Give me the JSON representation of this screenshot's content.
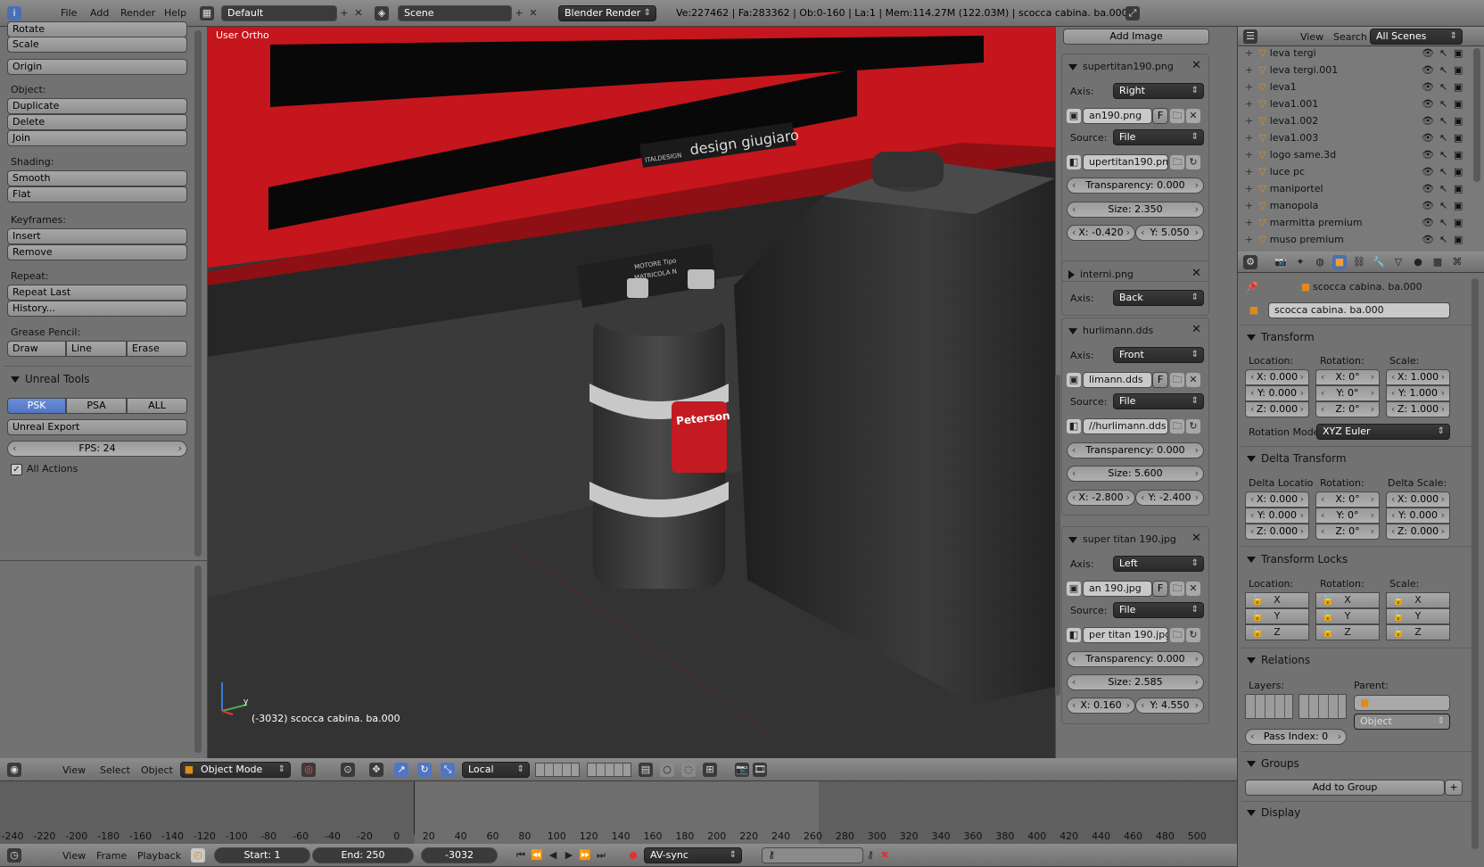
{
  "top_bar": {
    "menus": [
      "File",
      "Add",
      "Render",
      "Help"
    ],
    "layout": "Default",
    "scene": "Scene",
    "engine": "Blender Render",
    "stats": "Ve:227462 | Fa:283362 | Ob:0-160 | La:1 | Mem:114.27M (122.03M) | scocca cabina. ba.000"
  },
  "tools": {
    "rotate": "Rotate",
    "scale": "Scale",
    "origin": "Origin",
    "object_label": "Object:",
    "duplicate": "Duplicate",
    "delete": "Delete",
    "join": "Join",
    "shading_label": "Shading:",
    "smooth": "Smooth",
    "flat": "Flat",
    "keyframes_label": "Keyframes:",
    "insert": "Insert",
    "remove": "Remove",
    "repeat_label": "Repeat:",
    "repeat_last": "Repeat Last",
    "history": "History...",
    "grease_label": "Grease Pencil:",
    "draw": "Draw",
    "line": "Line",
    "erase": "Erase",
    "unreal_title": "Unreal Tools",
    "psk": "PSK",
    "psa": "PSA",
    "all": "ALL",
    "unreal_export": "Unreal Export",
    "fps": "FPS: 24",
    "all_actions": "All Actions"
  },
  "viewport": {
    "view_label": "User Ortho",
    "object_label": "(-3032) scocca cabina. ba.000",
    "logo_text": "design giugiaro",
    "logo_small": "ITALDESIGN",
    "plate_text_1": "MOTORE Tipo",
    "plate_text_2": "MATRICOLA N",
    "badge_text": "Peterson",
    "axis_y": "y"
  },
  "bg_panel": {
    "add_image": "Add Image",
    "images": [
      {
        "name": "supertitan190.png",
        "axis": "Right",
        "file": "an190.png",
        "source": "File",
        "path": "upertitan190.png",
        "transparency": "Transparency: 0.000",
        "size": "Size: 2.350",
        "x": "X: -0.420",
        "y": "Y: 5.050",
        "expanded": true
      },
      {
        "name": "interni.png",
        "axis": "Back",
        "expanded": false
      },
      {
        "name": "hurlimann.dds",
        "axis": "Front",
        "file": "limann.dds",
        "source": "File",
        "path": "//hurlimann.dds",
        "transparency": "Transparency: 0.000",
        "size": "Size: 5.600",
        "x": "X: -2.800",
        "y": "Y: -2.400",
        "expanded": true
      },
      {
        "name": "super titan 190.jpg",
        "axis": "Left",
        "file": "an 190.jpg",
        "source": "File",
        "path": "per titan 190.jpg",
        "transparency": "Transparency: 0.000",
        "size": "Size: 2.585",
        "x": "X: 0.160",
        "y": "Y: 4.550",
        "expanded": true
      }
    ],
    "axis_label": "Axis:",
    "source_label": "Source:",
    "f_label": "F"
  },
  "outliner": {
    "view": "View",
    "search": "Search",
    "all_scenes": "All Scenes",
    "items": [
      "leva tergi",
      "leva tergi.001",
      "leva1",
      "leva1.001",
      "leva1.002",
      "leva1.003",
      "logo same.3d",
      "luce pc",
      "maniportel",
      "manopola",
      "marmitta premium",
      "muso premium"
    ]
  },
  "properties": {
    "breadcrumb": "scocca cabina. ba.000",
    "object_name": "scocca cabina. ba.000",
    "transform_title": "Transform",
    "location_label": "Location:",
    "rotation_label": "Rotation:",
    "scale_label": "Scale:",
    "loc": [
      "X: 0.000",
      "Y: 0.000",
      "Z: 0.000"
    ],
    "rot": [
      "X: 0°",
      "Y: 0°",
      "Z: 0°"
    ],
    "scl": [
      "X: 1.000",
      "Y: 1.000",
      "Z: 1.000"
    ],
    "rotation_mode_label": "Rotation Mode",
    "rotation_mode": "XYZ Euler",
    "delta_title": "Delta Transform",
    "delta_location_label": "Delta Locatio",
    "delta_rotation_label": "Rotation:",
    "delta_scale_label": "Delta Scale:",
    "dloc": [
      "X: 0.000",
      "Y: 0.000",
      "Z: 0.000"
    ],
    "drot": [
      "X: 0°",
      "Y: 0°",
      "Z: 0°"
    ],
    "dscl": [
      "X: 0.000",
      "Y: 0.000",
      "Z: 0.000"
    ],
    "locks_title": "Transform Locks",
    "lock_axes": [
      "X",
      "Y",
      "Z"
    ],
    "relations_title": "Relations",
    "layers_label": "Layers:",
    "parent_label": "Parent:",
    "parent_type": "Object",
    "pass_index": "Pass Index: 0",
    "groups_title": "Groups",
    "add_to_group": "Add to Group",
    "display_title": "Display"
  },
  "view3d_header": {
    "view": "View",
    "select": "Select",
    "object": "Object",
    "mode": "Object Mode",
    "orientation": "Local"
  },
  "timeline": {
    "ticks": [
      "-240",
      "-220",
      "-200",
      "-180",
      "-160",
      "-140",
      "-120",
      "-100",
      "-80",
      "-60",
      "-40",
      "-20",
      "0",
      "20",
      "40",
      "60",
      "80",
      "100",
      "120",
      "140",
      "160",
      "180",
      "200",
      "220",
      "240",
      "260",
      "280",
      "300",
      "320",
      "340",
      "360",
      "380",
      "400",
      "420",
      "440",
      "460",
      "480",
      "500"
    ],
    "view": "View",
    "frame": "Frame",
    "playback": "Playback",
    "start": "Start: 1",
    "end": "End: 250",
    "current": "-3032",
    "sync": "AV-sync"
  }
}
